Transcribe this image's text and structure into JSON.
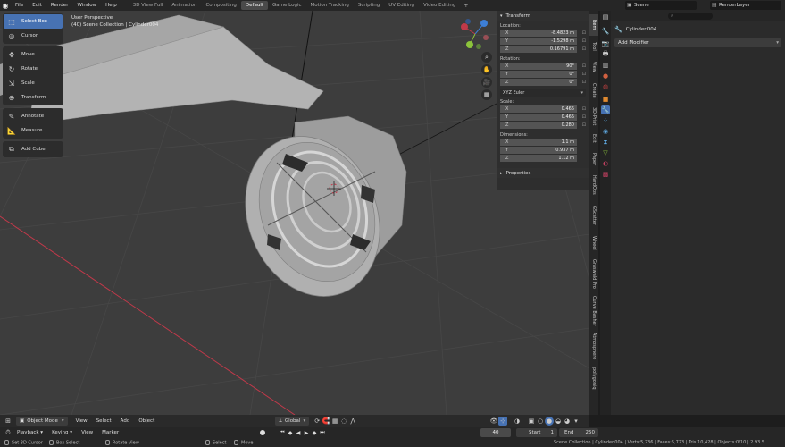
{
  "topbar": {
    "menus": [
      "File",
      "Edit",
      "Render",
      "Window",
      "Help"
    ],
    "workspaces": [
      "3D View Full",
      "Animation",
      "Compositing",
      "Default",
      "Game Logic",
      "Motion Tracking",
      "Scripting",
      "UV Editing",
      "Video Editing"
    ],
    "active_workspace": "Default",
    "add_workspace": "+",
    "scene": "Scene",
    "render_layer": "RenderLayer"
  },
  "viewport": {
    "perspective": "User Perspective",
    "collection_info": "(40) Scene Collection | Cylinder004"
  },
  "tools": [
    {
      "label": "Select Box",
      "icon": "select-box-icon",
      "active": true
    },
    {
      "label": "Cursor",
      "icon": "cursor-icon"
    },
    {
      "label": "Move",
      "icon": "move-icon"
    },
    {
      "label": "Rotate",
      "icon": "rotate-icon"
    },
    {
      "label": "Scale",
      "icon": "scale-icon"
    },
    {
      "label": "Transform",
      "icon": "transform-icon"
    },
    {
      "label": "Annotate",
      "icon": "annotate-icon"
    },
    {
      "label": "Measure",
      "icon": "measure-icon"
    },
    {
      "label": "Add Cube",
      "icon": "add-cube-icon"
    }
  ],
  "npanel": {
    "transform_header": "Transform",
    "location_label": "Location:",
    "location": [
      {
        "axis": "X",
        "value": "-8.4823 m"
      },
      {
        "axis": "Y",
        "value": "-1.5298 m"
      },
      {
        "axis": "Z",
        "value": "0.16791 m"
      }
    ],
    "rotation_label": "Rotation:",
    "rotation": [
      {
        "axis": "X",
        "value": "90°"
      },
      {
        "axis": "Y",
        "value": "0°"
      },
      {
        "axis": "Z",
        "value": "0°"
      }
    ],
    "rotation_mode": "XYZ Euler",
    "scale_label": "Scale:",
    "scale": [
      {
        "axis": "X",
        "value": "0.466"
      },
      {
        "axis": "Y",
        "value": "0.466"
      },
      {
        "axis": "Z",
        "value": "0.280"
      }
    ],
    "dimensions_label": "Dimensions:",
    "dimensions": [
      {
        "axis": "X",
        "value": "1.1 m"
      },
      {
        "axis": "Y",
        "value": "0.937 m"
      },
      {
        "axis": "Z",
        "value": "1.12 m"
      }
    ],
    "properties_header": "Properties"
  },
  "vtabs": [
    "Item",
    "Tool",
    "View",
    "Create",
    "3D-Print",
    "Edit",
    "Paper",
    "HardOps",
    "GScatter",
    "Wheel",
    "Graswald Pro",
    "Curve Basher",
    "Atmosphere",
    "polygoniq"
  ],
  "active_vtab": "Item",
  "properties": {
    "search_icon": "search-icon",
    "object_name": "Cylinder.004",
    "add_modifier": "Add Modifier"
  },
  "vp_header": {
    "mode": "Object Mode",
    "menus": [
      "View",
      "Select",
      "Add",
      "Object"
    ],
    "orientation": "Global"
  },
  "timeline": {
    "menus": [
      "Playback",
      "Keying",
      "View",
      "Marker"
    ],
    "current_frame": "40",
    "start_label": "Start",
    "start": "1",
    "end_label": "End",
    "end": "250"
  },
  "statusbar": {
    "left": [
      "Set 3D Cursor",
      "Box Select",
      "Rotate View",
      "Select",
      "Move"
    ],
    "stats": "Scene Collection | Cylinder.004 | Verts:5,236 | Faces:5,723 | Tris:10,428 | Objects:0/10 | 2.93.5"
  },
  "colors": {
    "accent": "#4772b3",
    "viewport_bg": "#3d3d3d",
    "x_axis": "#c0394a",
    "y_axis": "#8cc43b",
    "z_axis": "#3d7fd6"
  }
}
